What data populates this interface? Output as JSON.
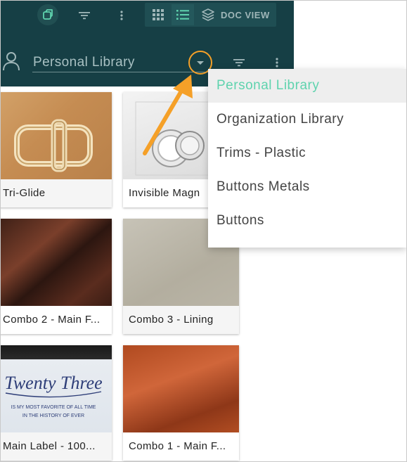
{
  "toolbar": {
    "icons": [
      "brand-logo-icon",
      "filter-icon",
      "more-vert-icon",
      "grid-view-icon",
      "list-view-icon",
      "layers-icon"
    ],
    "doc_view_label": "DOC VIEW"
  },
  "library_bar": {
    "icons": [
      "user-icon",
      "dropdown-arrow-icon",
      "filter-icon",
      "more-vert-icon"
    ],
    "selected": "Personal Library"
  },
  "dropdown": {
    "items": [
      {
        "label": "Personal Library",
        "selected": true
      },
      {
        "label": "Organization Library"
      },
      {
        "label": "Trims - Plastic"
      },
      {
        "label": "Buttons Metals"
      },
      {
        "label": "Buttons"
      }
    ]
  },
  "cards": [
    {
      "label": "Tri-Glide"
    },
    {
      "label": "Invisible Magn"
    },
    {
      "label": "Combo 2 - Main F..."
    },
    {
      "label": "Combo 3 - Lining"
    },
    {
      "label": "Main Label - 100..."
    },
    {
      "label": "Combo 1 - Main F..."
    }
  ],
  "card5_image": {
    "line1": "Twenty Three",
    "line2": "IS MY MOST FAVORITE OF ALL TIME",
    "line3": "IN THE HISTORY OF EVER"
  },
  "colors": {
    "header_bg": "#163f45",
    "accent": "#5fd3ae",
    "callout": "#f5a028"
  }
}
